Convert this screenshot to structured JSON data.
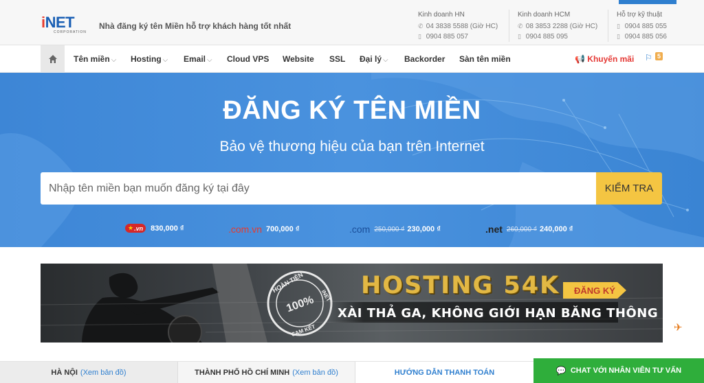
{
  "header": {
    "logo": "iNET",
    "logo_sub": "CORPORATION",
    "slogan": "Nhà đăng ký tên Miền hỗ trợ khách hàng tốt nhất",
    "contacts": [
      {
        "title": "Kinh doanh HN",
        "lines": [
          "04 3838 5588 (Giờ HC)",
          "0904 885 057"
        ]
      },
      {
        "title": "Kinh doanh HCM",
        "lines": [
          "08 3853 2288 (Giờ HC)",
          "0904 885 095"
        ]
      },
      {
        "title": "Hỗ trợ kỹ thuật",
        "lines": [
          "0904 885 055",
          "0904 885 056"
        ]
      }
    ]
  },
  "nav": {
    "items": [
      {
        "label": "Tên miền",
        "dropdown": true
      },
      {
        "label": "Hosting",
        "dropdown": true
      },
      {
        "label": "Email",
        "dropdown": true
      },
      {
        "label": "Cloud VPS",
        "dropdown": false
      },
      {
        "label": "Website",
        "dropdown": false
      },
      {
        "label": "SSL",
        "dropdown": false
      },
      {
        "label": "Đại lý",
        "dropdown": true
      },
      {
        "label": "Backorder",
        "dropdown": false
      },
      {
        "label": "Sàn tên miền",
        "dropdown": false
      }
    ],
    "dropdown_glyph": "⌵",
    "promo": "Khuyến mãi",
    "cart_count": "5"
  },
  "hero": {
    "title": "ĐĂNG KÝ TÊN MIỀN",
    "subtitle": "Bảo vệ thương hiệu của bạn trên Internet",
    "search_placeholder": "Nhập tên miền bạn muốn đăng ký tại đây",
    "check_label": "KIỂM TRA",
    "prices": [
      {
        "tld": ".vn",
        "old": "",
        "price": "830,000 ₫"
      },
      {
        "tld": ".com.vn",
        "old": "",
        "price": "700,000 ₫"
      },
      {
        "tld": ".com",
        "old": "250,000 ₫",
        "price": "230,000 ₫"
      },
      {
        "tld": ".net",
        "old": "260,000 ₫",
        "price": "240,000 ₫"
      }
    ]
  },
  "banner": {
    "headline": "HOSTING 54K",
    "tag": "ĐĂNG KÝ",
    "slogan": "XÀI THẢ GA, KHÔNG GIỚI HẠN BĂNG THÔNG",
    "seal_top": "HOÀN TIỀN",
    "seal_brand": "iNET",
    "seal_percent": "100%",
    "seal_bottom": "CAM KẾT"
  },
  "footer_bar": {
    "hn_city": "HÀ NỘI",
    "hn_link": "(Xem bản đồ)",
    "hcm_city": "THÀNH PHỐ HỒ CHÍ MINH",
    "hcm_link": "(Xem bản đồ)",
    "guide": "HƯỚNG DẪN THANH TOÁN",
    "chat": "CHAT VỚI NHÂN VIÊN TƯ VẤN"
  }
}
